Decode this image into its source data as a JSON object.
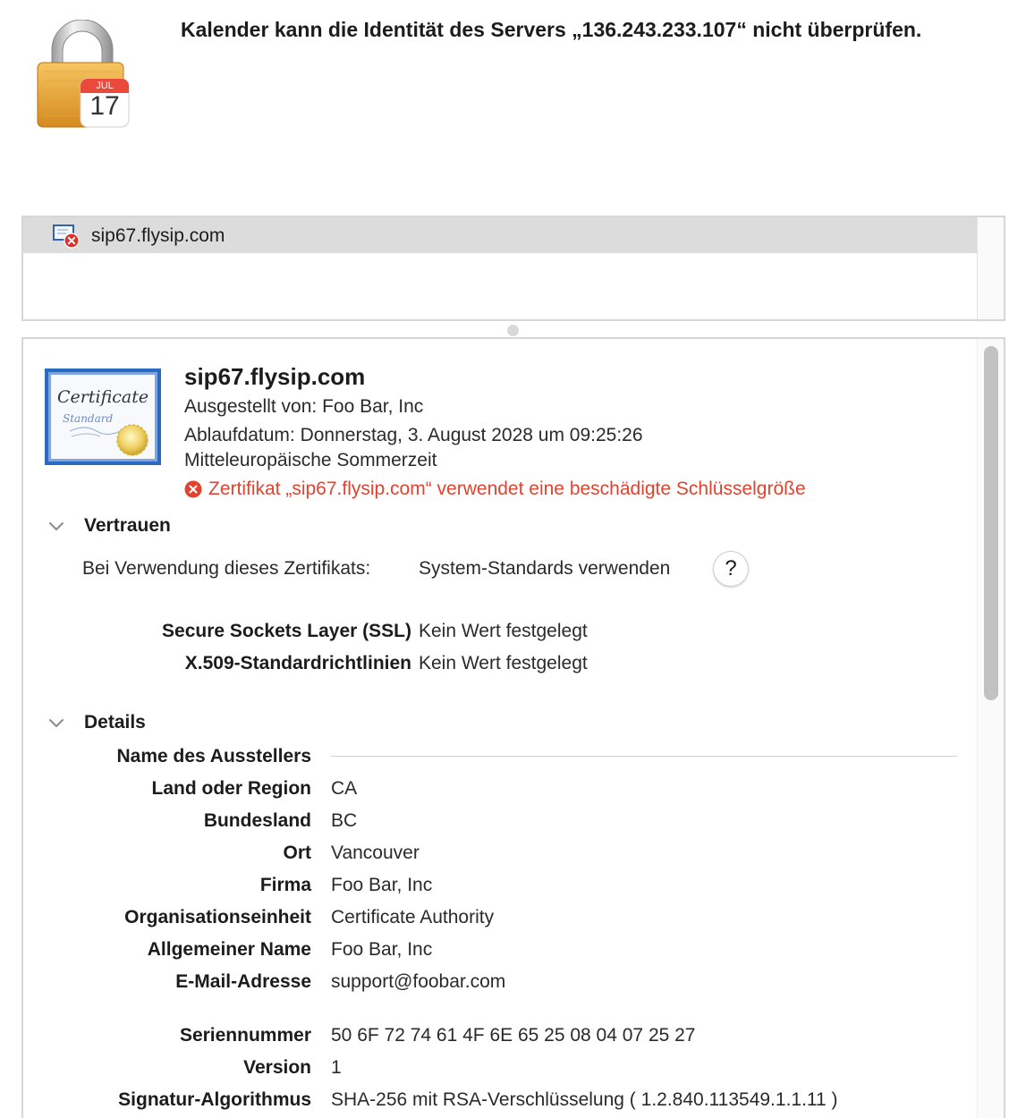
{
  "header": {
    "title": "Kalender kann die Identität des Servers „136.243.233.107“ nicht überprüfen.",
    "calendar_month": "JUL",
    "calendar_day": "17"
  },
  "cert_list": {
    "items": [
      {
        "label": "sip67.flysip.com",
        "icon": "certificate-error-icon",
        "selected": true
      }
    ]
  },
  "certificate": {
    "icon_text_line1": "Certificate",
    "icon_text_line2": "Standard",
    "name": "sip67.flysip.com",
    "issued_by": "Ausgestellt von: Foo Bar, Inc",
    "expiry_line1": "Ablaufdatum: Donnerstag, 3. August 2028 um 09:25:26",
    "expiry_line2": "Mitteleuropäische Sommerzeit",
    "error": "Zertifikat „sip67.flysip.com“ verwendet eine beschädigte Schlüsselgröße",
    "error_color": "#e0432f"
  },
  "trust": {
    "title": "Vertrauen",
    "usage_label": "Bei Verwendung dieses Zertifikats:",
    "usage_value": "System-Standards verwenden",
    "help_label": "?",
    "policies": [
      {
        "label": "Secure Sockets Layer (SSL)",
        "value": "Kein Wert festgelegt"
      },
      {
        "label": "X.509-Standardrichtlinien",
        "value": "Kein Wert festgelegt"
      }
    ]
  },
  "details": {
    "title": "Details",
    "issuer_heading": "Name des Ausstellers",
    "issuer": [
      {
        "label": "Land oder Region",
        "value": "CA"
      },
      {
        "label": "Bundesland",
        "value": "BC"
      },
      {
        "label": "Ort",
        "value": "Vancouver"
      },
      {
        "label": "Firma",
        "value": "Foo Bar, Inc"
      },
      {
        "label": "Organisationseinheit",
        "value": "Certificate Authority"
      },
      {
        "label": "Allgemeiner Name",
        "value": "Foo Bar, Inc"
      },
      {
        "label": "E-Mail-Adresse",
        "value": "support@foobar.com"
      }
    ],
    "fields": [
      {
        "label": "Seriennummer",
        "value": "50 6F 72 74 61 4F 6E 65 25 08 04 07 25 27"
      },
      {
        "label": "Version",
        "value": "1"
      },
      {
        "label": "Signatur-Algorithmus",
        "value": "SHA-256 mit RSA-Verschlüsselung ( 1.2.840.113549.1.1.11 )"
      }
    ]
  }
}
